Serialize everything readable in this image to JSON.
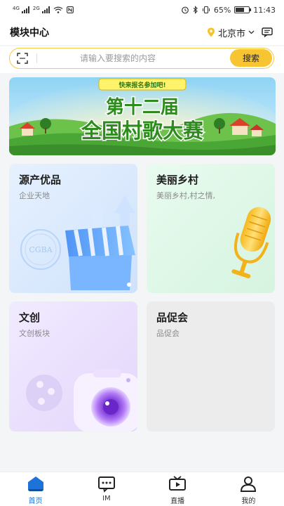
{
  "status_bar": {
    "network_left": "4G",
    "network_right": "2G",
    "battery": "65%",
    "battery_level": 0.65,
    "time": "11:43"
  },
  "header": {
    "title": "模块中心",
    "city": "北京市"
  },
  "search": {
    "placeholder": "请输入要搜索的内容",
    "button": "搜索"
  },
  "banner": {
    "tag": "快来报名参加吧!",
    "line1": "第十二届",
    "line2": "全国村歌大赛"
  },
  "cards": [
    {
      "title": "源产优品",
      "subtitle": "企业天地",
      "art_text": "CGBA"
    },
    {
      "title": "美丽乡村",
      "subtitle": "美丽乡村,村之情,"
    },
    {
      "title": "文创",
      "subtitle": "文创板块"
    },
    {
      "title": "品促会",
      "subtitle": "品促会"
    }
  ],
  "tabs": [
    {
      "label": "首页",
      "icon": "home-icon",
      "active": true
    },
    {
      "label": "IM",
      "icon": "chat-icon",
      "active": false
    },
    {
      "label": "直播",
      "icon": "tv-icon",
      "active": false
    },
    {
      "label": "我的",
      "icon": "profile-icon",
      "active": false
    }
  ],
  "colors": {
    "accent": "#f7c531",
    "active_tab": "#1e73d8",
    "search_border": "#f2c94c"
  }
}
